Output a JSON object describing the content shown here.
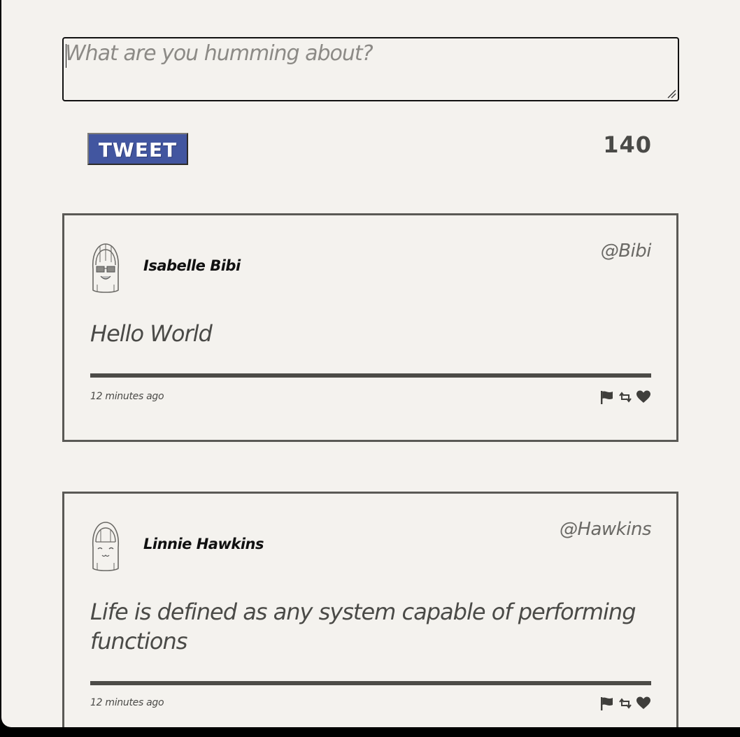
{
  "composer": {
    "placeholder": "What are you humming about?",
    "tweet_button_label": "TWEET",
    "char_counter": "140"
  },
  "tweets": [
    {
      "author_name": "Isabelle Bibi",
      "handle": "@Bibi",
      "text": "Hello World",
      "timestamp": "12 minutes ago",
      "avatar_icon": "avatar-glasses-icon"
    },
    {
      "author_name": "Linnie Hawkins",
      "handle": "@Hawkins",
      "text": "Life is defined as any system capable of performing functions",
      "timestamp": "12 minutes ago",
      "avatar_icon": "avatar-smile-icon"
    }
  ],
  "action_icons": [
    "flag-icon",
    "retweet-icon",
    "heart-icon"
  ],
  "colors": {
    "background": "#f4f2ee",
    "tweet_button": "#4256a0",
    "text": "#4a4a47",
    "border": "#5a5955"
  }
}
